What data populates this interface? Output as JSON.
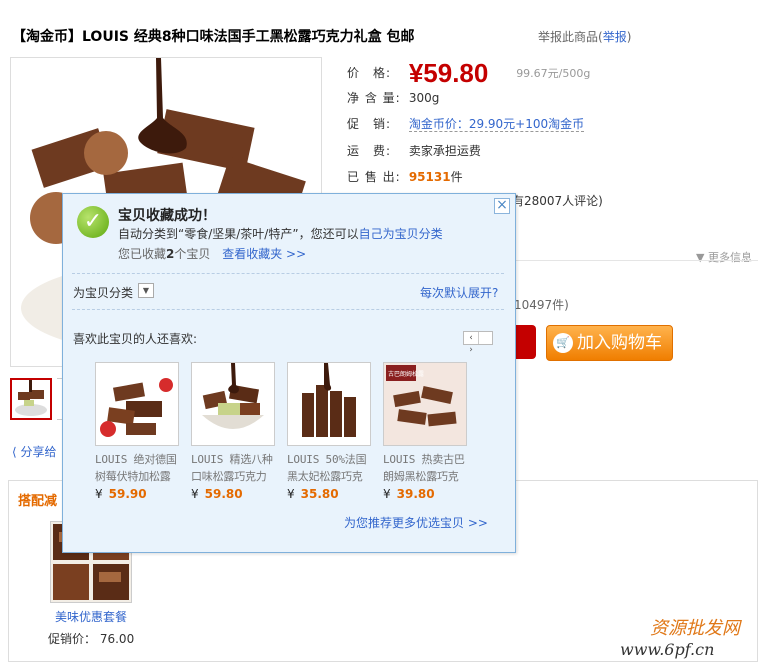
{
  "product": {
    "title": "【淘金币】LOUIS 经典8种口味法国手工黑松露巧克力礼盒 包邮",
    "report_prefix": "举报此商品(",
    "report_link": "举报",
    "report_suffix": ")"
  },
  "props": {
    "price_label": "价　格:",
    "price": "¥59.80",
    "price_per_unit": "99.67元/500g",
    "net_label": "净 含 量:",
    "net_value": "300g",
    "promo_label": "促　销:",
    "promo_value": "淘金币价：29.90元+100淘金币",
    "shipping_label": "运　费:",
    "shipping_value": "卖家承担运费",
    "sold_label": "已 售 出:",
    "sold_value": "95131",
    "sold_unit": "件",
    "comment_tail": "有28007人评论)",
    "more_info": "▼ 更多信息",
    "deal_tail": "10497件)"
  },
  "buttons": {
    "add_to_cart": "加入购物车",
    "share": "分享给"
  },
  "popup": {
    "title": "宝贝收藏成功！",
    "line1_prefix": "自动分类到“零食/坚果/茶叶/特产”，您还可以",
    "line1_link": "自己为宝贝分类",
    "line2_prefix": "您已收藏",
    "line2_count": "2",
    "line2_suffix": "个宝贝",
    "line2_link": "查看收藏夹 >>",
    "category_label": "为宝贝分类",
    "expand_link": "每次默认展开?",
    "like_label": "喜欢此宝贝的人还喜欢:",
    "pager_prev": "‹",
    "pager_next": "›",
    "recs": [
      {
        "name": "LOUIS 绝对德国树莓伏特加松露",
        "currency": "¥",
        "price": "59.90"
      },
      {
        "name": "LOUIS 精选八种口味松露巧克力",
        "currency": "¥",
        "price": "59.80"
      },
      {
        "name": "LOUIS 50%法国黑太妃松露巧克",
        "currency": "¥",
        "price": "35.80"
      },
      {
        "name": "LOUIS 热卖古巴朗姆黑松露巧克",
        "currency": "¥",
        "price": "39.80"
      }
    ],
    "rec4_badge": "古巴朗姆松露",
    "more_recs": "为您推荐更多优选宝贝 >>"
  },
  "combo": {
    "title": "搭配减",
    "name": "美味优惠套餐",
    "price_label": "促销价：",
    "price": "76.00"
  },
  "watermark": {
    "line1": "资源批发网",
    "line2": "www.6pf.cn"
  },
  "colors": {
    "price_red": "#c40000",
    "accent_orange": "#e46a00",
    "link_blue": "#3366cc",
    "popup_bg": "#e9f3fc"
  }
}
